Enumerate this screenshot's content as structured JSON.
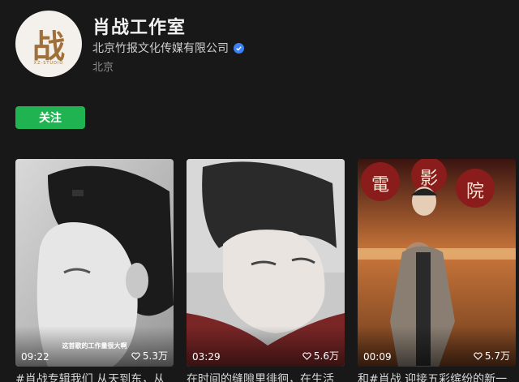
{
  "profile": {
    "avatar_glyph": "战",
    "avatar_mono": "XZ-STUDIO",
    "name": "肖战工作室",
    "verified_org": "北京竹报文化传媒有限公司",
    "location": "北京"
  },
  "follow_label": "关注",
  "videos": [
    {
      "duration": "09:22",
      "likes": "5.3万",
      "overlay": "这首歌的工作量很大啊",
      "caption": "#肖战专辑我们 从天到东，从"
    },
    {
      "duration": "03:29",
      "likes": "5.6万",
      "overlay": "",
      "caption": "在时间的缝隙里徘徊，在生活"
    },
    {
      "duration": "00:09",
      "likes": "5.7万",
      "overlay": "",
      "sign_chars": [
        "電",
        "影",
        "院"
      ],
      "caption": "和#肖战 迎接五彩缤纷的新一"
    }
  ],
  "icons": {
    "verified": "check-badge-icon",
    "like": "heart-outline-icon"
  },
  "colors": {
    "follow": "#20b352",
    "badge": "#3b82f6",
    "sign": "#8b1c1c"
  }
}
